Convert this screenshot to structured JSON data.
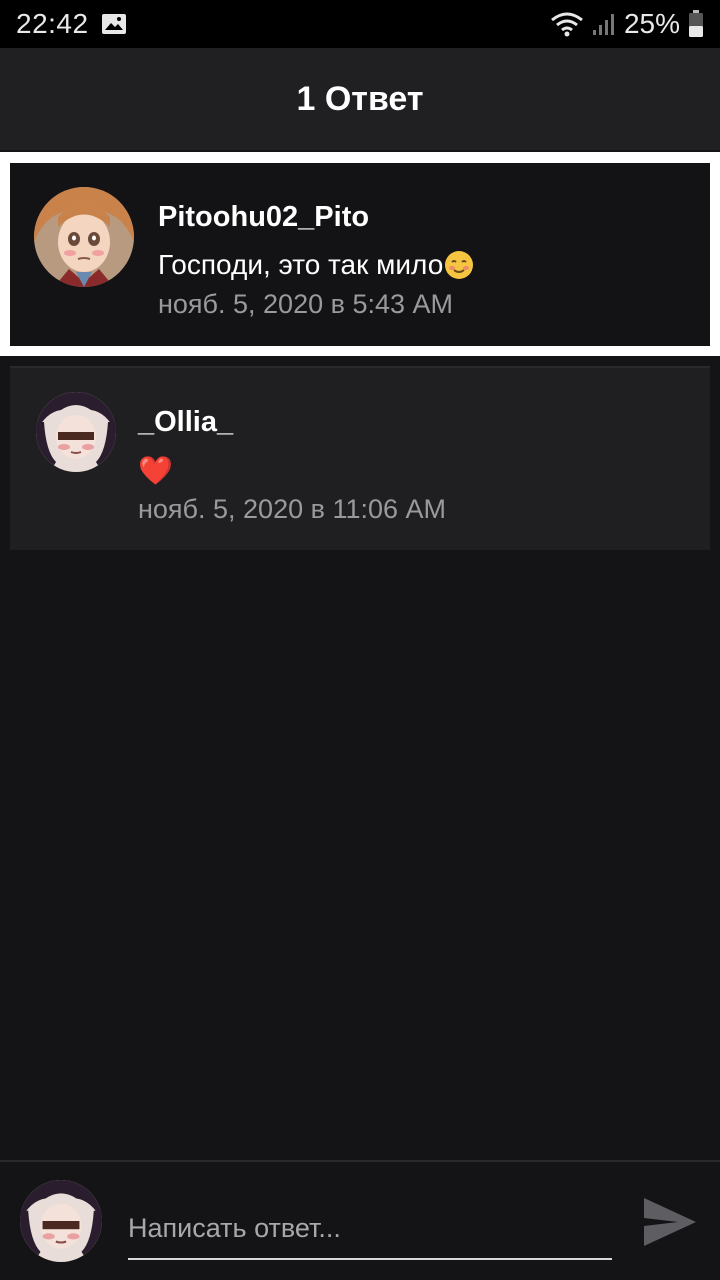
{
  "status_bar": {
    "time": "22:42",
    "battery": "25%",
    "icons": [
      "gallery-icon",
      "wifi-icon",
      "signal-icon",
      "battery-icon"
    ]
  },
  "header": {
    "title": "1 Ответ"
  },
  "parent_comment": {
    "author": "Pitoohu02_Pito",
    "text": "Господи, это так мило",
    "emoji": "smiling-face-emoji",
    "timestamp": "нояб. 5, 2020 в 5:43 AM"
  },
  "replies": [
    {
      "author": "_Ollia_",
      "text": "❤️",
      "timestamp": "нояб. 5, 2020 в 11:06 AM"
    }
  ],
  "composer": {
    "placeholder": "Написать ответ...",
    "send_icon": "send-icon"
  },
  "colors": {
    "background": "#141316",
    "header": "#202022",
    "card": "#1f1f21",
    "highlight_border": "#ffffff",
    "secondary_text": "#9a999c"
  }
}
